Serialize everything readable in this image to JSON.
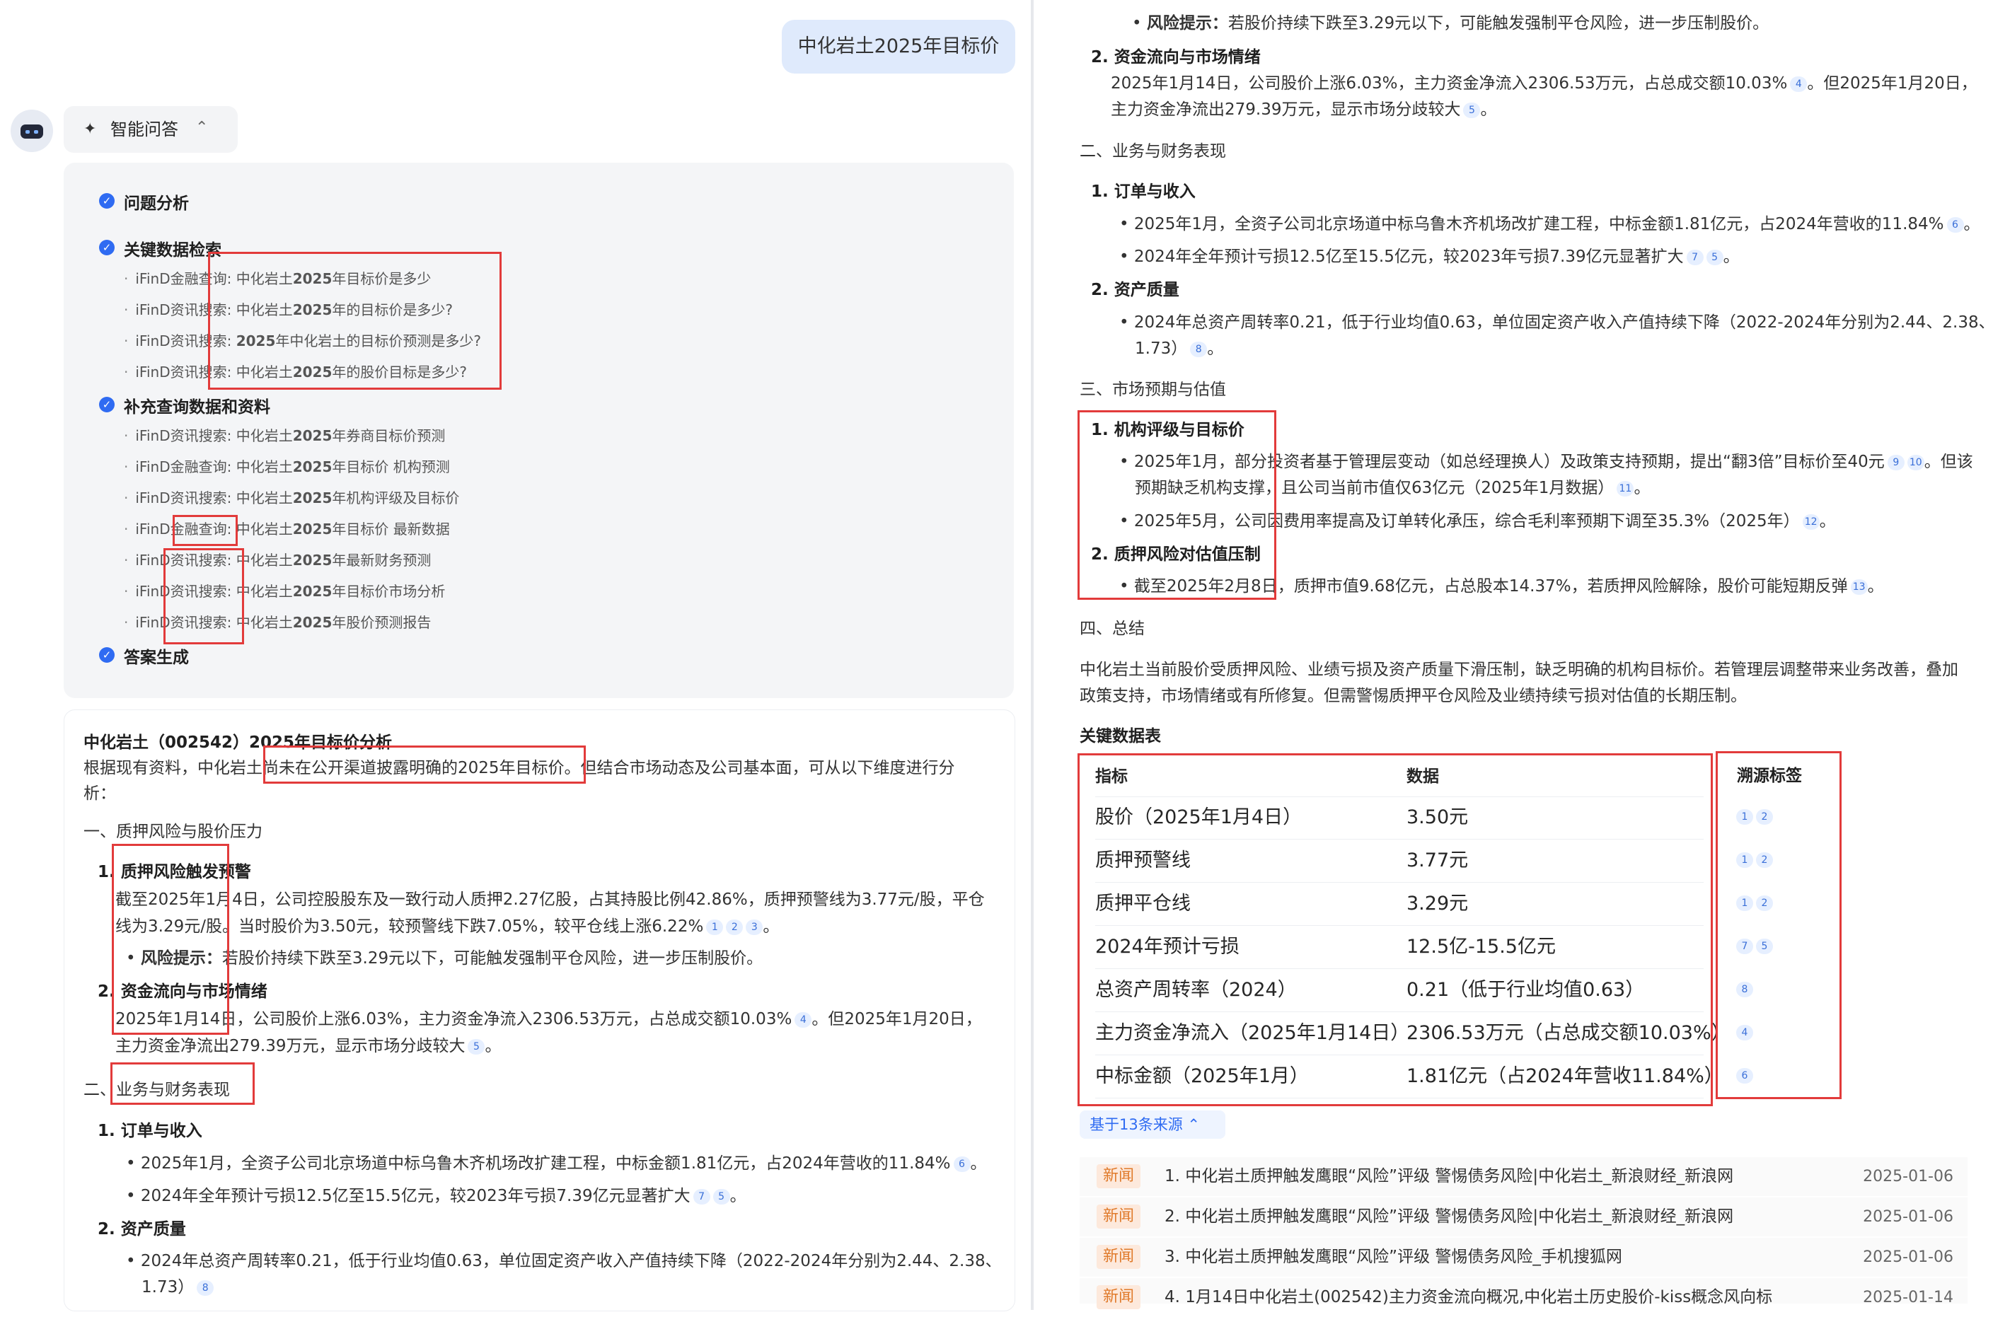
{
  "user_query": "中化岩土2025年目标价",
  "assistant": {
    "chip_label": "智能问答",
    "steps": {
      "analysis": "问题分析",
      "key_search": "关键数据检索",
      "key_items": [
        {
          "src": "iFinD金融查询:",
          "q_pre": "中化岩土",
          "q_bold": "2025",
          "q_post": "年目标价是多少"
        },
        {
          "src": "iFinD资讯搜索:",
          "q_pre": "中化岩土",
          "q_bold": "2025",
          "q_post": "年的目标价是多少?"
        },
        {
          "src": "iFinD资讯搜索:",
          "q_pre": "",
          "q_bold": "2025",
          "q_post": "年中化岩土的目标价预测是多少?"
        },
        {
          "src": "iFinD资讯搜索:",
          "q_pre": "中化岩土",
          "q_bold": "2025",
          "q_post": "年的股价目标是多少?"
        }
      ],
      "supplement": "补充查询数据和资料",
      "supp_items": [
        {
          "src": "iFinD资讯搜索:",
          "q_pre": "中化岩土",
          "q_bold": "2025",
          "q_post": "年券商目标价预测"
        },
        {
          "src": "iFinD金融查询:",
          "q_pre": "中化岩土",
          "q_bold": "2025",
          "q_post": "年目标价 机构预测"
        },
        {
          "src": "iFinD资讯搜索:",
          "q_pre": "中化岩土",
          "q_bold": "2025",
          "q_post": "年机构评级及目标价"
        },
        {
          "src": "iFinD金融查询:",
          "q_pre": "中化岩土",
          "q_bold": "2025",
          "q_post": "年目标价 最新数据"
        },
        {
          "src": "iFinD资讯搜索:",
          "q_pre": "中化岩土",
          "q_bold": "2025",
          "q_post": "年最新财务预测"
        },
        {
          "src": "iFinD资讯搜索:",
          "q_pre": "中化岩土",
          "q_bold": "2025",
          "q_post": "年目标价市场分析"
        },
        {
          "src": "iFinD资讯搜索:",
          "q_pre": "中化岩土",
          "q_bold": "2025",
          "q_post": "年股价预测报告"
        }
      ],
      "answer": "答案生成"
    }
  },
  "answer": {
    "title": "中化岩土（002542）2025年目标价分析",
    "intro_1": "根据现有资料，中化岩土尚未在公开渠道披露明确的2025年目标价。但结合市场动态及公司基本面，可从以下维度进行分",
    "intro_2": "析：",
    "s1": "一、质押风险与股价压力",
    "s1_1": "1. 质押风险触发预警",
    "s1_1_l1": "截至2025年1月4日，公司控股股东及一致行动人质押2.27亿股，占其持股比例42.86%，质押预警线为3.77元/股，平仓",
    "s1_1_l2": "线为3.29元/股。当时股价为3.50元，较预警线下跌7.05%，较平仓线上涨6.22%",
    "risk_label": "风险提示：",
    "risk_text": "若股价持续下跌至3.29元以下，可能触发强制平仓风险，进一步压制股价。",
    "s1_2": "2. 资金流向与市场情绪",
    "s1_2_l1": "2025年1月14日，公司股价上涨6.03%，主力资金净流入2306.53万元，占总成交额10.03%",
    "s1_2_l1b": "。但2025年1月20日，",
    "s1_2_l2": "主力资金净流出279.39万元，显示市场分歧较大",
    "s2": "二、业务与财务表现",
    "s2_1": "1. 订单与收入",
    "s2_1_b1": "2025年1月，全资子公司北京场道中标乌鲁木齐机场改扩建工程，中标金额1.81亿元，占2024年营收的11.84%",
    "s2_1_b2": "2024年全年预计亏损12.5亿至15.5亿元，较2023年亏损7.39亿元显著扩大",
    "s2_2": "2. 资产质量",
    "s2_2_b1": "2024年总资产周转率0.21，低于行业均值0.63，单位固定资产收入产值持续下降（2022-2024年分别为2.44、2.38、",
    "s2_2_b1b": "1.73）",
    "s3": "三、市场预期与估值",
    "s3_1": "1. 机构评级与目标价",
    "s3_1_b1": "2025年1月，部分投资者基于管理层变动（如总经理换人）及政策支持预期，提出“翻3倍”目标价至40元",
    "s3_1_b1c": "。但该",
    "s3_1_b1b": "预期缺乏机构支撑，且公司当前市值仅63亿元（2025年1月数据）",
    "s3_1_b2": "2025年5月，公司因费用率提高及订单转化承压，综合毛利率预期下调至35.3%（2025年）",
    "s3_2": "2. 质押风险对估值压制",
    "s3_2_b1": "截至2025年2月8日，质押市值9.68亿元，占总股本14.37%，若质押风险解除，股价可能短期反弹",
    "s4": "四、总结",
    "summary_1": "中化岩土当前股价受质押风险、业绩亏损及资产质量下滑压制，缺乏明确的机构目标价。若管理层调整带来业务改善，叠加",
    "summary_2": "政策支持，市场情绪或有所修复。但需警惕质押平仓风险及业绩持续亏损对估值的长期压制。",
    "table_title": "关键数据表",
    "table_headers": [
      "指标",
      "数据",
      "溯源标签"
    ],
    "table_rows": [
      {
        "metric": "股价（2025年1月4日）",
        "value": "3.50元",
        "tags": [
          "1",
          "2"
        ]
      },
      {
        "metric": "质押预警线",
        "value": "3.77元",
        "tags": [
          "1",
          "2"
        ]
      },
      {
        "metric": "质押平仓线",
        "value": "3.29元",
        "tags": [
          "1",
          "2"
        ]
      },
      {
        "metric": "2024年预计亏损",
        "value": "12.5亿-15.5亿元",
        "tags": [
          "7",
          "5"
        ]
      },
      {
        "metric": "总资产周转率（2024）",
        "value": "0.21（低于行业均值0.63）",
        "tags": [
          "8"
        ]
      },
      {
        "metric": "主力资金净流入（2025年1月14日）",
        "value": "2306.53万元（占总成交额10.03%）",
        "tags": [
          "4"
        ]
      },
      {
        "metric": "中标金额（2025年1月）",
        "value": "1.81亿元（占2024年营收11.84%）",
        "tags": [
          "6"
        ]
      }
    ],
    "sources_button": "基于13条来源",
    "news_tag": "新闻",
    "news": [
      {
        "title": "1. 中化岩土质押触发鹰眼“风险”评级 警惕债务风险|中化岩土_新浪财经_新浪网",
        "date": "2025-01-06"
      },
      {
        "title": "2. 中化岩土质押触发鹰眼“风险”评级 警惕债务风险|中化岩土_新浪财经_新浪网",
        "date": "2025-01-06"
      },
      {
        "title": "3. 中化岩土质押触发鹰眼“风险”评级 警惕债务风险_手机搜狐网",
        "date": "2025-01-06"
      },
      {
        "title": "4. 1月14日中化岩土(002542)主力资金流向概况,中化岩土历史股价-kiss概念风向标",
        "date": "2025-01-14"
      }
    ]
  },
  "colors": {
    "accent": "#2f6bf2",
    "highlight_box": "#e23b3b",
    "bubble": "#dfeafc"
  }
}
